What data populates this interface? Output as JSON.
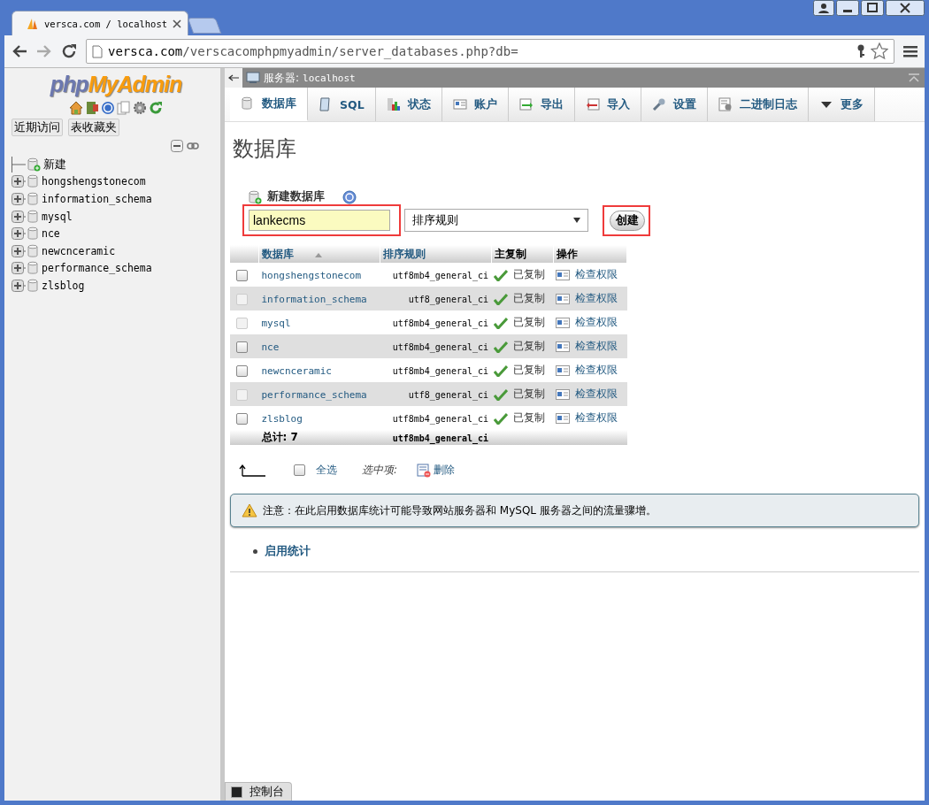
{
  "window": {
    "tab_title": "versca.com / localhost",
    "address_host": "versca.com",
    "address_path": "/verscacomphpmyadmin/server_databases.php?db="
  },
  "sidebar": {
    "logo_php": "php",
    "logo_myadmin": "MyAdmin",
    "recent_button": "近期访问",
    "favorites_button": "表收藏夹",
    "tree": [
      {
        "label": "新建",
        "kind": "new"
      },
      {
        "label": "hongshengstonecom",
        "kind": "db"
      },
      {
        "label": "information_schema",
        "kind": "db"
      },
      {
        "label": "mysql",
        "kind": "db"
      },
      {
        "label": "nce",
        "kind": "db"
      },
      {
        "label": "newcnceramic",
        "kind": "db"
      },
      {
        "label": "performance_schema",
        "kind": "db"
      },
      {
        "label": "zlsblog",
        "kind": "db"
      }
    ]
  },
  "server_bar": {
    "label": "服务器:",
    "host": "localhost"
  },
  "tabs": [
    {
      "label": "数据库",
      "kind": "db",
      "selected": true
    },
    {
      "label": "SQL",
      "kind": "sql",
      "selected": false
    },
    {
      "label": "状态",
      "kind": "chart",
      "selected": false
    },
    {
      "label": "账户",
      "kind": "card",
      "selected": false
    },
    {
      "label": "导出",
      "kind": "export",
      "selected": false
    },
    {
      "label": "导入",
      "kind": "import",
      "selected": false
    },
    {
      "label": "设置",
      "kind": "wrench",
      "selected": false
    },
    {
      "label": "二进制日志",
      "kind": "log",
      "selected": false
    },
    {
      "label": "更多",
      "kind": "more",
      "selected": false
    }
  ],
  "heading": "数据库",
  "create_form": {
    "title": "新建数据库",
    "name_value": "lankecms",
    "collation_placeholder": "排序规则",
    "button": "创建"
  },
  "table": {
    "columns": [
      "数据库",
      "排序规则",
      "主复制",
      "操作"
    ],
    "rows": [
      {
        "name": "hongshengstonecom",
        "collation": "utf8mb4_general_ci",
        "replication": "已复制",
        "action": "检查权限",
        "disabled": false
      },
      {
        "name": "information_schema",
        "collation": "utf8_general_ci",
        "replication": "已复制",
        "action": "检查权限",
        "disabled": true
      },
      {
        "name": "mysql",
        "collation": "utf8mb4_general_ci",
        "replication": "已复制",
        "action": "检查权限",
        "disabled": true
      },
      {
        "name": "nce",
        "collation": "utf8mb4_general_ci",
        "replication": "已复制",
        "action": "检查权限",
        "disabled": false
      },
      {
        "name": "newcnceramic",
        "collation": "utf8mb4_general_ci",
        "replication": "已复制",
        "action": "检查权限",
        "disabled": false
      },
      {
        "name": "performance_schema",
        "collation": "utf8_general_ci",
        "replication": "已复制",
        "action": "检查权限",
        "disabled": true
      },
      {
        "name": "zlsblog",
        "collation": "utf8mb4_general_ci",
        "replication": "已复制",
        "action": "检查权限",
        "disabled": false
      }
    ],
    "footer_total": "总计: 7",
    "footer_collation": "utf8mb4_general_ci"
  },
  "bulk": {
    "checked": false,
    "check_all": "全选",
    "with_selected": "选中项:",
    "delete": "删除"
  },
  "notice": "注意：在此启用数据库统计可能导致网站服务器和 MySQL 服务器之间的流量骤增。",
  "enable_stats": "启用统计",
  "console": "控制台"
}
